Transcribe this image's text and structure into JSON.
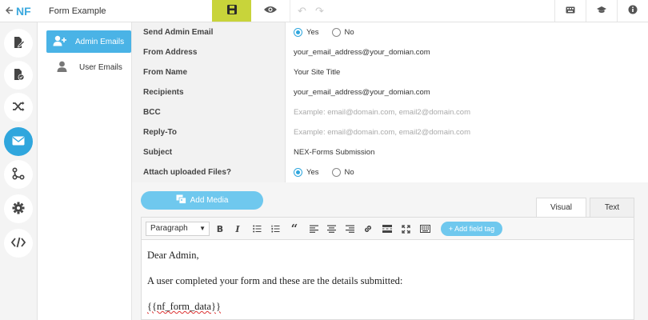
{
  "topbar": {
    "form_title": "Form Example",
    "logo_text": "NF",
    "icons": [
      "back-arrow-icon",
      "save-icon",
      "eye-icon",
      "undo-icon",
      "redo-icon",
      "keyboard-icon",
      "graduation-cap-icon",
      "info-icon"
    ]
  },
  "colors": {
    "accent_blue": "#2fa6dd",
    "save_green": "#c8d43a",
    "button_light_blue": "#6fc8ee"
  },
  "rail": {
    "items": [
      "form-edit-icon",
      "file-check-icon",
      "shuffle-icon",
      "envelope-icon",
      "workflow-icon",
      "gear-icon",
      "code-icon"
    ],
    "active": "envelope-icon"
  },
  "submenu": {
    "items": [
      {
        "label": "Admin Emails",
        "active": true
      },
      {
        "label": "User Emails",
        "active": false
      }
    ]
  },
  "settings": {
    "send_admin_email": {
      "label": "Send Admin Email",
      "yes": "Yes",
      "no": "No",
      "selected": "Yes"
    },
    "from_address": {
      "label": "From Address",
      "value": "your_email_address@your_domian.com"
    },
    "from_name": {
      "label": "From Name",
      "value": "Your Site Title"
    },
    "recipients": {
      "label": "Recipients",
      "value": "your_email_address@your_domian.com"
    },
    "bcc": {
      "label": "BCC",
      "placeholder": "Example: email@domain.com, email2@domain.com"
    },
    "reply_to": {
      "label": "Reply-To",
      "placeholder": "Example: email@domain.com, email2@domain.com"
    },
    "subject": {
      "label": "Subject",
      "value": "NEX-Forms Submission"
    },
    "attach_files": {
      "label": "Attach uploaded Files?",
      "yes": "Yes",
      "no": "No",
      "selected": "Yes"
    }
  },
  "editor": {
    "add_media_label": "Add Media",
    "tabs": {
      "visual": "Visual",
      "text": "Text",
      "active": "Visual"
    },
    "format_select": "Paragraph",
    "add_field_tag_label": "+ Add field tag",
    "body": {
      "line1": "Dear Admin,",
      "line2": "A user completed your form and these are the details submitted:",
      "line3": "{{nf_form_data}}"
    }
  }
}
